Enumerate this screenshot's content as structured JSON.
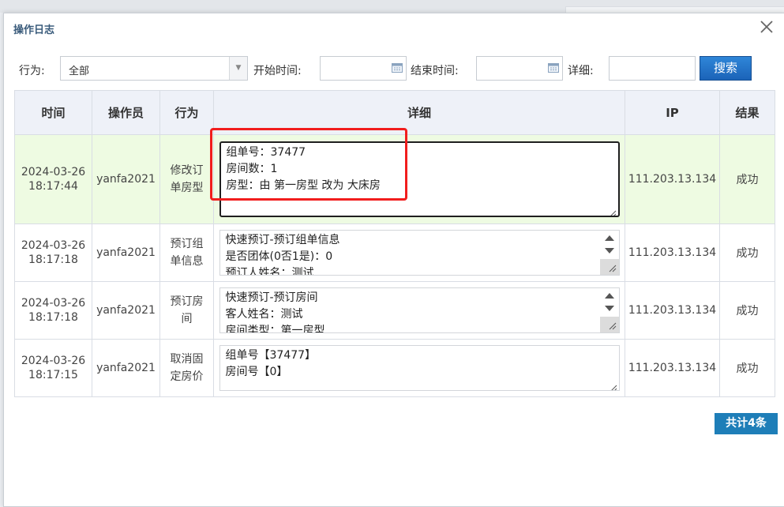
{
  "dialog": {
    "title": "操作日志",
    "close_icon": "close-icon"
  },
  "filter": {
    "action_label": "行为:",
    "action_selected": "全部",
    "start_label": "开始时间:",
    "start_value": "",
    "end_label": "结束时间:",
    "end_value": "",
    "detail_label": "详细:",
    "detail_value": "",
    "search_label": "搜索"
  },
  "table": {
    "headers": [
      "时间",
      "操作员",
      "行为",
      "详细",
      "IP",
      "结果"
    ],
    "rows": [
      {
        "date": "2024-03-26",
        "time": "18:17:44",
        "operator": "yanfa2021",
        "action": "修改订单房型",
        "detail": [
          "组单号：37477",
          "房间数：1",
          "房型：由 第一房型 改为 大床房"
        ],
        "ip": "111.203.13.134",
        "result": "成功"
      },
      {
        "date": "2024-03-26",
        "time": "18:17:18",
        "operator": "yanfa2021",
        "action": "预订组单信息",
        "detail": [
          "快速预订-预订组单信息",
          "是否团体(0否1是)：0",
          "预订人姓名：测试"
        ],
        "ip": "111.203.13.134",
        "result": "成功"
      },
      {
        "date": "2024-03-26",
        "time": "18:17:18",
        "operator": "yanfa2021",
        "action": "预订房间",
        "detail": [
          "快速预订-预订房间",
          "客人姓名：测试",
          "房间类型：第一房型"
        ],
        "ip": "111.203.13.134",
        "result": "成功"
      },
      {
        "date": "2024-03-26",
        "time": "18:17:15",
        "operator": "yanfa2021",
        "action": "取消固定房价",
        "detail": [
          "组单号【37477】",
          "房间号【0】"
        ],
        "ip": "111.203.13.134",
        "result": "成功"
      }
    ]
  },
  "footer": {
    "count_label": "共计4条"
  },
  "colors": {
    "highlight": "#f11d1d",
    "primary": "#1b63b8",
    "row_highlight": "#eefbe2"
  }
}
